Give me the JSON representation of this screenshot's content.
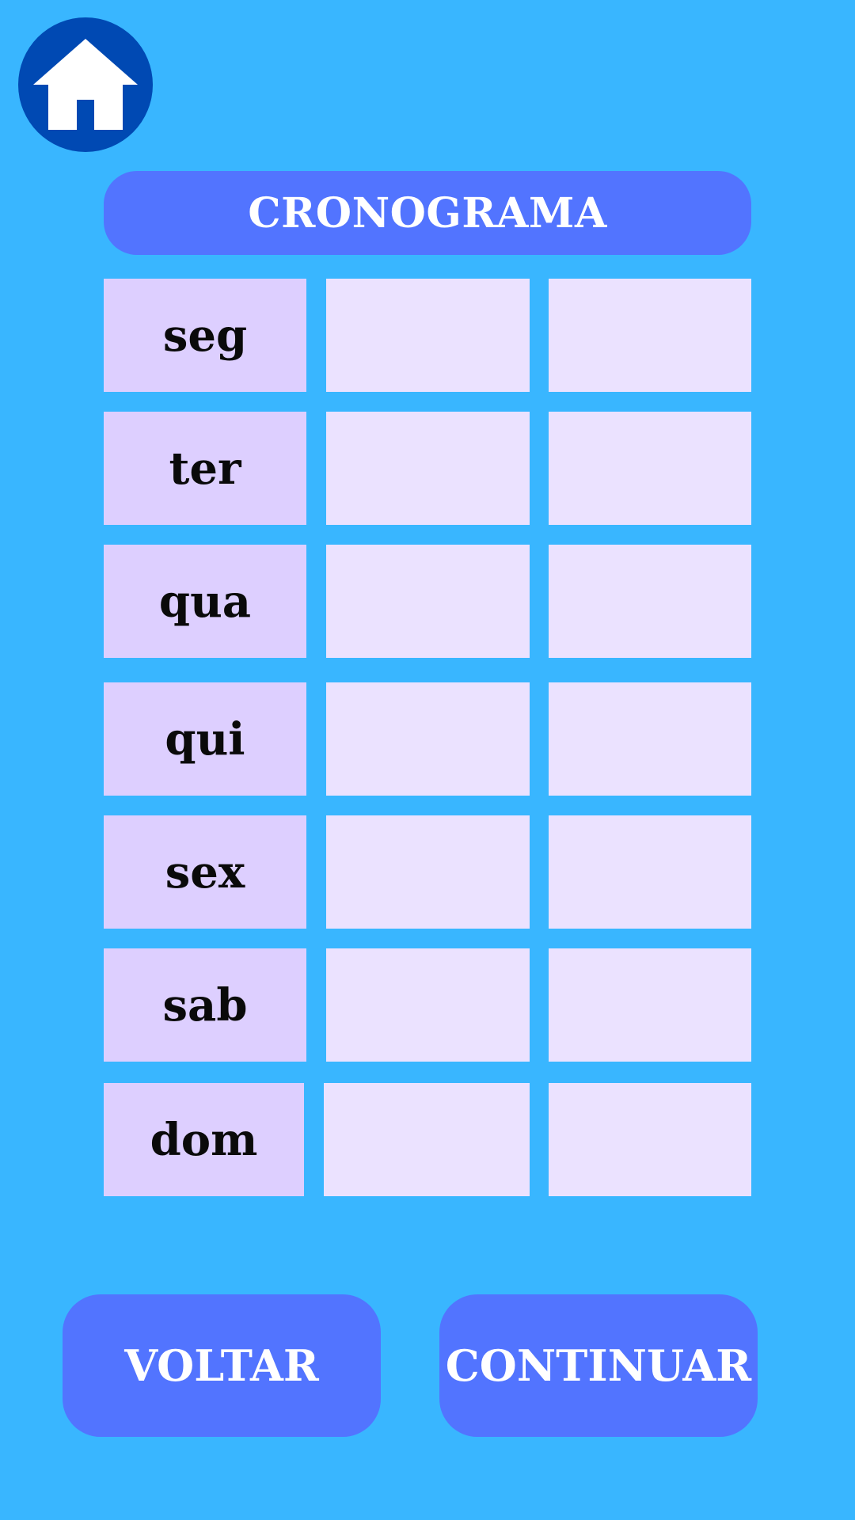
{
  "colors": {
    "background": "#39b6ff",
    "home_button": "#0049b3",
    "accent": "#5274ff",
    "day_cell": "#ddcfff",
    "slot_cell": "#ebe2ff",
    "label_text": "#0a0a0a",
    "button_text": "#ffffff"
  },
  "header": {
    "home_icon": "home-icon",
    "title": "CRONOGRAMA"
  },
  "schedule": {
    "days": [
      {
        "label": "seg",
        "slots": [
          "",
          ""
        ]
      },
      {
        "label": "ter",
        "slots": [
          "",
          ""
        ]
      },
      {
        "label": "qua",
        "slots": [
          "",
          ""
        ]
      },
      {
        "label": "qui",
        "slots": [
          "",
          ""
        ]
      },
      {
        "label": "sex",
        "slots": [
          "",
          ""
        ]
      },
      {
        "label": "sab",
        "slots": [
          "",
          ""
        ]
      },
      {
        "label": "dom",
        "slots": [
          "",
          ""
        ]
      }
    ]
  },
  "footer": {
    "back_label": "VOLTAR",
    "continue_label": "CONTINUAR"
  }
}
